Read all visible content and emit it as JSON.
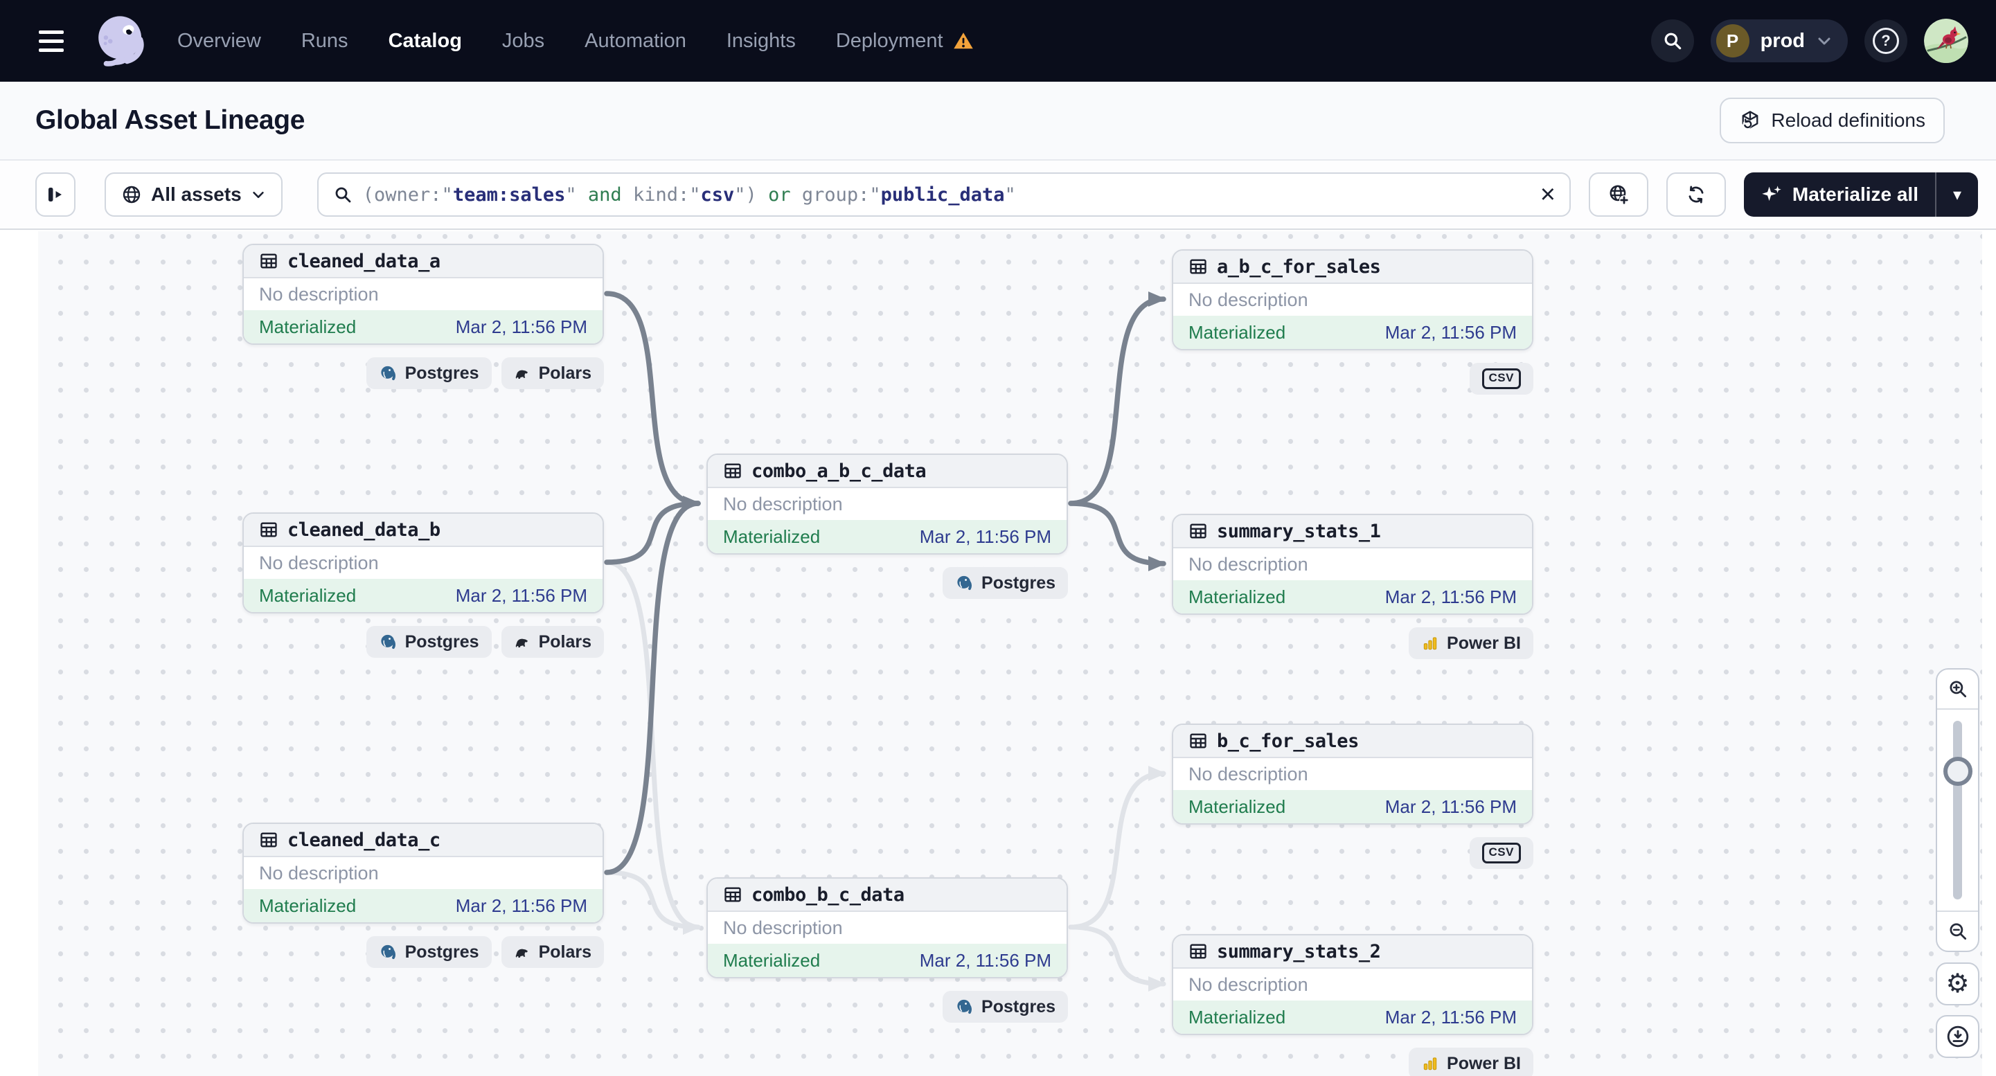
{
  "nav": {
    "items": [
      {
        "label": "Overview",
        "active": false,
        "warning": false
      },
      {
        "label": "Runs",
        "active": false,
        "warning": false
      },
      {
        "label": "Catalog",
        "active": true,
        "warning": false
      },
      {
        "label": "Jobs",
        "active": false,
        "warning": false
      },
      {
        "label": "Automation",
        "active": false,
        "warning": false
      },
      {
        "label": "Insights",
        "active": false,
        "warning": false
      },
      {
        "label": "Deployment",
        "active": false,
        "warning": true
      }
    ],
    "environment": "prod",
    "environment_initial": "P",
    "help_label": "?"
  },
  "header": {
    "title": "Global Asset Lineage",
    "reload_label": "Reload definitions"
  },
  "toolbar": {
    "scope_label": "All assets",
    "materialize_label": "Materialize all",
    "query_tokens": [
      {
        "text": "(owner:",
        "cls": "plain"
      },
      {
        "text": "\"",
        "cls": "quote"
      },
      {
        "text": "team:sales",
        "cls": "value"
      },
      {
        "text": "\"",
        "cls": "quote"
      },
      {
        "text": " ",
        "cls": "plain"
      },
      {
        "text": "and",
        "cls": "op"
      },
      {
        "text": " kind:",
        "cls": "plain"
      },
      {
        "text": "\"",
        "cls": "quote"
      },
      {
        "text": "csv",
        "cls": "value"
      },
      {
        "text": "\"",
        "cls": "quote"
      },
      {
        "text": ")",
        "cls": "plain"
      },
      {
        "text": " ",
        "cls": "plain"
      },
      {
        "text": "or",
        "cls": "op"
      },
      {
        "text": " group:",
        "cls": "plain"
      },
      {
        "text": "\"",
        "cls": "quote"
      },
      {
        "text": "public_data",
        "cls": "value"
      },
      {
        "text": "\"",
        "cls": "quote"
      }
    ]
  },
  "icons": {
    "gear": "⚙",
    "clear": "×",
    "caret": "▾"
  },
  "graph": {
    "tag_labels": {
      "postgres": "Postgres",
      "polars": "Polars",
      "csv": "csv",
      "powerbi": "Power BI"
    },
    "nodes": [
      {
        "id": "cleaned_data_a",
        "name": "cleaned_data_a",
        "description": "No description",
        "status": "Materialized",
        "timestamp": "Mar 2, 11:56 PM",
        "tags": [
          "postgres",
          "polars"
        ]
      },
      {
        "id": "cleaned_data_b",
        "name": "cleaned_data_b",
        "description": "No description",
        "status": "Materialized",
        "timestamp": "Mar 2, 11:56 PM",
        "tags": [
          "postgres",
          "polars"
        ]
      },
      {
        "id": "cleaned_data_c",
        "name": "cleaned_data_c",
        "description": "No description",
        "status": "Materialized",
        "timestamp": "Mar 2, 11:56 PM",
        "tags": [
          "postgres",
          "polars"
        ]
      },
      {
        "id": "combo_a_b_c_data",
        "name": "combo_a_b_c_data",
        "description": "No description",
        "status": "Materialized",
        "timestamp": "Mar 2, 11:56 PM",
        "tags": [
          "postgres"
        ]
      },
      {
        "id": "combo_b_c_data",
        "name": "combo_b_c_data",
        "description": "No description",
        "status": "Materialized",
        "timestamp": "Mar 2, 11:56 PM",
        "tags": [
          "postgres"
        ]
      },
      {
        "id": "a_b_c_for_sales",
        "name": "a_b_c_for_sales",
        "description": "No description",
        "status": "Materialized",
        "timestamp": "Mar 2, 11:56 PM",
        "tags": [
          "csv"
        ]
      },
      {
        "id": "summary_stats_1",
        "name": "summary_stats_1",
        "description": "No description",
        "status": "Materialized",
        "timestamp": "Mar 2, 11:56 PM",
        "tags": [
          "powerbi"
        ]
      },
      {
        "id": "b_c_for_sales",
        "name": "b_c_for_sales",
        "description": "No description",
        "status": "Materialized",
        "timestamp": "Mar 2, 11:56 PM",
        "tags": [
          "csv"
        ]
      },
      {
        "id": "summary_stats_2",
        "name": "summary_stats_2",
        "description": "No description",
        "status": "Materialized",
        "timestamp": "Mar 2, 11:56 PM",
        "tags": [
          "powerbi"
        ]
      }
    ],
    "edges": [
      {
        "from": "cleaned_data_b",
        "to": "combo_b_c_data",
        "emphasis": false
      },
      {
        "from": "cleaned_data_c",
        "to": "combo_b_c_data",
        "emphasis": false
      },
      {
        "from": "combo_b_c_data",
        "to": "b_c_for_sales",
        "emphasis": false
      },
      {
        "from": "combo_b_c_data",
        "to": "summary_stats_2",
        "emphasis": false
      },
      {
        "from": "cleaned_data_a",
        "to": "combo_a_b_c_data",
        "emphasis": true
      },
      {
        "from": "cleaned_data_b",
        "to": "combo_a_b_c_data",
        "emphasis": true
      },
      {
        "from": "cleaned_data_c",
        "to": "combo_a_b_c_data",
        "emphasis": true
      },
      {
        "from": "combo_a_b_c_data",
        "to": "a_b_c_for_sales",
        "emphasis": true
      },
      {
        "from": "combo_a_b_c_data",
        "to": "summary_stats_1",
        "emphasis": true
      }
    ]
  },
  "colors": {
    "nav_bg": "#0a0d1b",
    "accent_green": "#1f7c4d",
    "status_bg": "#e6f4ec",
    "timestamp_blue": "#2e3b8f",
    "edge_emphasis": "#79828f",
    "edge_muted": "#e0e3e8",
    "warning_orange": "#f2a23b",
    "brand_lavender": "#cdcbee",
    "postgres_blue": "#336791",
    "powerbi_yellow": "#e9b411"
  }
}
